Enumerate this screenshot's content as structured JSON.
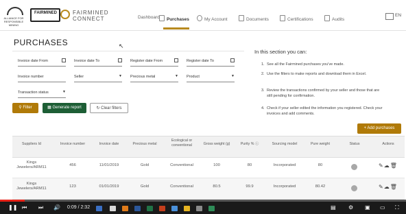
{
  "header": {
    "logo_alliance_text": "ALLIANCE FOR RESPONSIBLE MINING",
    "logo_arm_text": "FAIRMINED",
    "brand_line1": "FAIRMINED",
    "brand_line2": "CONNECT",
    "nav": [
      {
        "label": "Dashboard",
        "icon": "none"
      },
      {
        "label": "Purchases",
        "icon": "document-icon",
        "active": true
      },
      {
        "label": "My Account",
        "icon": "user-icon"
      },
      {
        "label": "Documents",
        "icon": "document-icon"
      },
      {
        "label": "Certifications",
        "icon": "certificate-icon"
      },
      {
        "label": "Audits",
        "icon": "audit-icon"
      }
    ],
    "lang": "EN"
  },
  "page": {
    "title": "PURCHASES"
  },
  "filters": {
    "invoice_date_from": "Invoice date From",
    "invoice_date_to": "Invoice date To",
    "register_date_from": "Register date From",
    "register_date_to": "Register date To",
    "invoice_number": "Invoice number",
    "seller": "Seller",
    "precious_metal": "Precious metal",
    "product": "Product",
    "transaction_status": "Transaction status"
  },
  "buttons": {
    "filter": "Filter",
    "generate_report": "Generate report",
    "clear_filters": "Clear filters",
    "add_purchases": "+ Add purchases"
  },
  "info": {
    "title": "In this section you can:",
    "items": [
      {
        "n": "1.",
        "text": "See all the Fairmined purchases you've made."
      },
      {
        "n": "2.",
        "text": "Use the filters to make reports and download them in Excel."
      },
      {
        "n": "3.",
        "text": "Review the transactions confirmed by your seller and those that are still pending for confirmation."
      },
      {
        "n": "4.",
        "text": "Check if your seller edited the information you registered. Check your invoices and add comments."
      }
    ]
  },
  "table": {
    "headers": [
      "Suppliers Id",
      "Invoice number",
      "Invoice date",
      "Precious metal",
      "Ecological or conventional",
      "Gross weight (g)",
      "Purity %",
      "Sourcing model",
      "Pure weight",
      "Status",
      "Actions"
    ],
    "rows": [
      {
        "supplier": "Kings Jewelers/ARM11",
        "invoice_number": "456",
        "invoice_date": "11/01/2019",
        "metal": "Gold",
        "type": "Conventional",
        "gross": "100",
        "purity": "80",
        "model": "Incorporated",
        "pure": "80"
      },
      {
        "supplier": "Kings Jewelers/ARM11",
        "invoice_number": "123",
        "invoice_date": "01/01/2019",
        "metal": "Gold",
        "type": "Conventional",
        "gross": "80.5",
        "purity": "99.9",
        "model": "Incorporated",
        "pure": "80.42"
      }
    ]
  },
  "video": {
    "time": "0:09 / 2:32",
    "played_fraction": 0.06
  }
}
